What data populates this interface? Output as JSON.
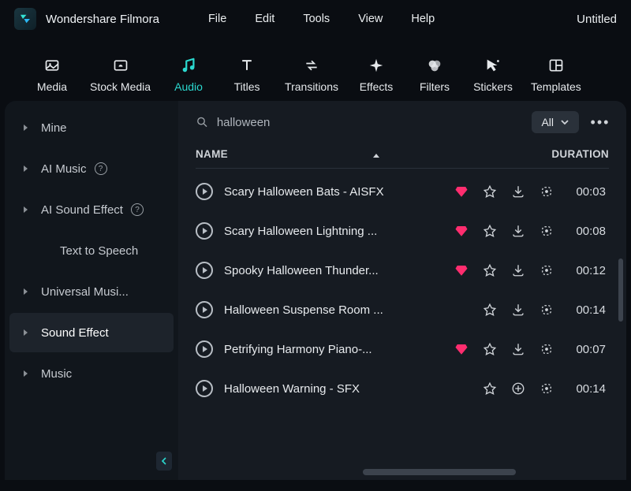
{
  "app": {
    "name": "Wondershare Filmora",
    "project": "Untitled"
  },
  "menubar": [
    "File",
    "Edit",
    "Tools",
    "View",
    "Help"
  ],
  "topnav": [
    {
      "id": "media",
      "label": "Media"
    },
    {
      "id": "stock-media",
      "label": "Stock Media"
    },
    {
      "id": "audio",
      "label": "Audio",
      "active": true
    },
    {
      "id": "titles",
      "label": "Titles"
    },
    {
      "id": "transitions",
      "label": "Transitions"
    },
    {
      "id": "effects",
      "label": "Effects"
    },
    {
      "id": "filters",
      "label": "Filters"
    },
    {
      "id": "stickers",
      "label": "Stickers"
    },
    {
      "id": "templates",
      "label": "Templates"
    }
  ],
  "sidebar": {
    "items": [
      {
        "label": "Mine",
        "chev": true
      },
      {
        "label": "AI Music",
        "chev": true,
        "help": true
      },
      {
        "label": "AI Sound Effect",
        "chev": true,
        "help": true
      },
      {
        "label": "Text to Speech",
        "chev": false
      },
      {
        "label": "Universal Musi...",
        "chev": true
      },
      {
        "label": "Sound Effect",
        "chev": true,
        "selected": true
      },
      {
        "label": "Music",
        "chev": true
      }
    ]
  },
  "search": {
    "query": "halloween",
    "placeholder": "Search"
  },
  "filter": {
    "label": "All"
  },
  "table": {
    "columns": {
      "name": "NAME",
      "duration": "DURATION"
    },
    "rows": [
      {
        "title": "Scary Halloween Bats - AISFX",
        "duration": "00:03",
        "premium": true,
        "download": true
      },
      {
        "title": "Scary Halloween Lightning ...",
        "duration": "00:08",
        "premium": true,
        "download": true
      },
      {
        "title": "Spooky Halloween Thunder...",
        "duration": "00:12",
        "premium": true,
        "download": true
      },
      {
        "title": "Halloween Suspense Room ...",
        "duration": "00:14",
        "premium": false,
        "download": true
      },
      {
        "title": "Petrifying Harmony Piano-...",
        "duration": "00:07",
        "premium": true,
        "download": true
      },
      {
        "title": "Halloween Warning - SFX",
        "duration": "00:14",
        "premium": false,
        "download": false
      }
    ]
  }
}
